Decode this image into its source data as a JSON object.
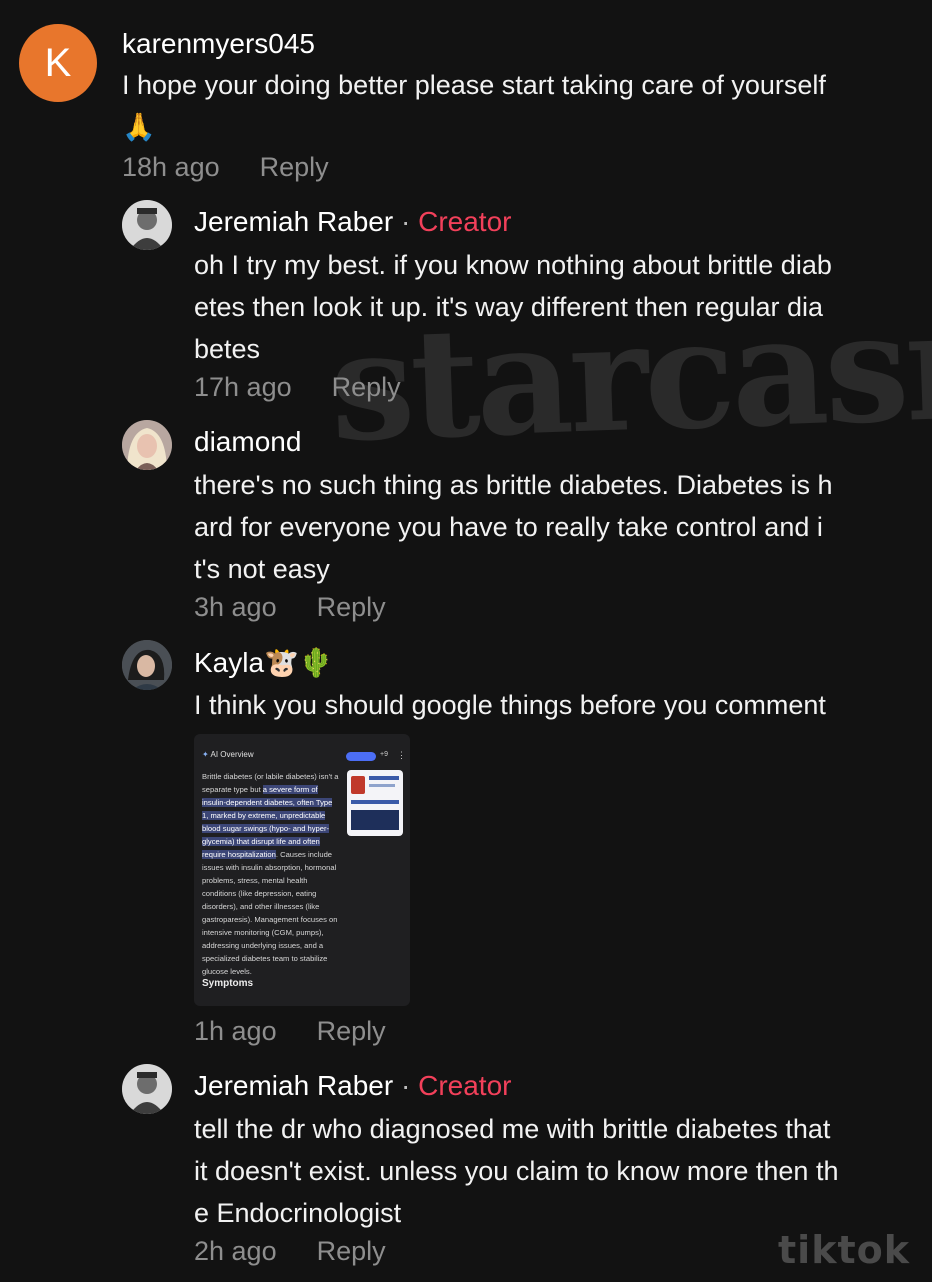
{
  "watermark": "starcasm",
  "platform_mark": "tiktok",
  "comments": [
    {
      "avatar_letter": "K",
      "username": "karenmyers045",
      "text_lines": [
        "I hope your doing better please start taking care of yourself",
        "🙏"
      ],
      "time": "18h ago",
      "reply": "Reply"
    },
    {
      "username": "Jeremiah Raber",
      "separator": "·",
      "badge": "Creator",
      "text_lines": [
        "oh I try my best. if you know nothing about brittle diab",
        "etes then look it up. it's way different then regular dia",
        "betes"
      ],
      "time": "17h ago",
      "reply": "Reply"
    },
    {
      "username": "diamond",
      "text_lines": [
        "there's no such thing as brittle diabetes. Diabetes is h",
        "ard for everyone you have to really take control and i",
        "t's not easy"
      ],
      "time": "3h ago",
      "reply": "Reply"
    },
    {
      "username": "Kayla🐮🌵",
      "text_lines": [
        "I think you should google things before you comment"
      ],
      "time": "1h ago",
      "reply": "Reply",
      "attachment": {
        "header": "AI Overview",
        "more_sources": "+9",
        "body_plain_1": "Brittle diabetes (or labile diabetes) isn't a separate type but ",
        "body_highlight": "a severe form of insulin-dependent diabetes, often Type 1, marked by extreme, unpredictable blood sugar swings (hypo- and hyper-glycemia) that disrupt life and often require hospitalization",
        "body_plain_2": ". Causes include issues with insulin absorption, hormonal problems, stress, mental health conditions (like depression, eating disorders), and other illnesses (like gastroparesis). Management focuses on intensive monitoring (CGM, pumps), addressing underlying issues, and a specialized diabetes team to stabilize glucose levels.",
        "section": "Symptoms"
      }
    },
    {
      "username": "Jeremiah Raber",
      "separator": "·",
      "badge": "Creator",
      "text_lines": [
        "tell the dr who diagnosed me with brittle diabetes that",
        "it doesn't exist. unless you claim to know more then th",
        "e Endocrinologist"
      ],
      "time": "2h ago",
      "reply": "Reply"
    }
  ],
  "colors": {
    "background": "#121212",
    "creator_badge": "#f2405a",
    "meta_text": "#8e8e8e",
    "avatar_k": "#e8762c"
  }
}
